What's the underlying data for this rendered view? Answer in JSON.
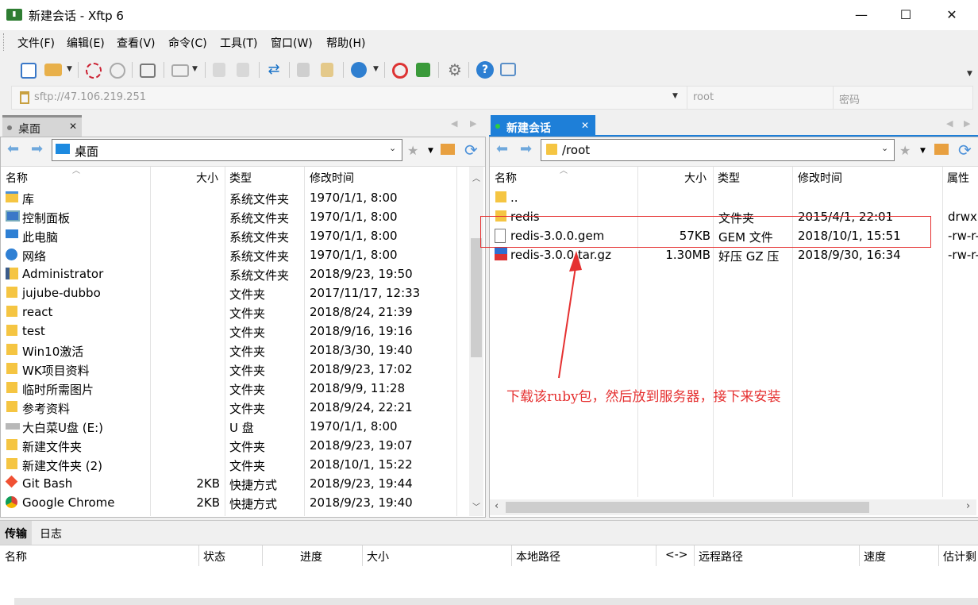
{
  "window": {
    "title": "新建会话  - Xftp 6"
  },
  "menu": [
    "文件(F)",
    "编辑(E)",
    "查看(V)",
    "命令(C)",
    "工具(T)",
    "窗口(W)",
    "帮助(H)"
  ],
  "address": {
    "url": "sftp://47.106.219.251",
    "user": "root",
    "password_placeholder": "密码"
  },
  "left_pane": {
    "tab": "桌面",
    "path": "桌面",
    "columns": [
      "名称",
      "大小",
      "类型",
      "修改时间"
    ],
    "rows": [
      {
        "name": "库",
        "size": "",
        "type": "系统文件夹",
        "date": "1970/1/1, 8:00",
        "icon": "library-icon"
      },
      {
        "name": "控制面板",
        "size": "",
        "type": "系统文件夹",
        "date": "1970/1/1, 8:00",
        "icon": "control-panel-icon"
      },
      {
        "name": "此电脑",
        "size": "",
        "type": "系统文件夹",
        "date": "1970/1/1, 8:00",
        "icon": "computer-icon"
      },
      {
        "name": "网络",
        "size": "",
        "type": "系统文件夹",
        "date": "1970/1/1, 8:00",
        "icon": "network-icon"
      },
      {
        "name": "Administrator",
        "size": "",
        "type": "系统文件夹",
        "date": "2018/9/23, 19:50",
        "icon": "user-folder-icon"
      },
      {
        "name": "jujube-dubbo",
        "size": "",
        "type": "文件夹",
        "date": "2017/11/17, 12:33",
        "icon": "folder-icon"
      },
      {
        "name": "react",
        "size": "",
        "type": "文件夹",
        "date": "2018/8/24, 21:39",
        "icon": "folder-icon"
      },
      {
        "name": "test",
        "size": "",
        "type": "文件夹",
        "date": "2018/9/16, 19:16",
        "icon": "folder-icon"
      },
      {
        "name": "Win10激活",
        "size": "",
        "type": "文件夹",
        "date": "2018/3/30, 19:40",
        "icon": "folder-icon"
      },
      {
        "name": "WK项目资料",
        "size": "",
        "type": "文件夹",
        "date": "2018/9/23, 17:02",
        "icon": "folder-icon"
      },
      {
        "name": "临时所需图片",
        "size": "",
        "type": "文件夹",
        "date": "2018/9/9, 11:28",
        "icon": "folder-icon"
      },
      {
        "name": "参考资料",
        "size": "",
        "type": "文件夹",
        "date": "2018/9/24, 22:21",
        "icon": "folder-icon"
      },
      {
        "name": "大白菜U盘 (E:)",
        "size": "",
        "type": "U 盘",
        "date": "1970/1/1, 8:00",
        "icon": "usb-drive-icon"
      },
      {
        "name": "新建文件夹",
        "size": "",
        "type": "文件夹",
        "date": "2018/9/23, 19:07",
        "icon": "folder-icon"
      },
      {
        "name": "新建文件夹 (2)",
        "size": "",
        "type": "文件夹",
        "date": "2018/10/1, 15:22",
        "icon": "folder-icon"
      },
      {
        "name": "Git Bash",
        "size": "2KB",
        "type": "快捷方式",
        "date": "2018/9/23, 19:44",
        "icon": "git-bash-icon"
      },
      {
        "name": "Google Chrome",
        "size": "2KB",
        "type": "快捷方式",
        "date": "2018/9/23, 19:40",
        "icon": "chrome-icon"
      }
    ]
  },
  "right_pane": {
    "tab": "新建会话",
    "path": "/root",
    "columns": [
      "名称",
      "大小",
      "类型",
      "修改时间",
      "属性"
    ],
    "rows": [
      {
        "name": "..",
        "size": "",
        "type": "",
        "date": "",
        "attr": "",
        "icon": "folder-icon"
      },
      {
        "name": "redis",
        "size": "",
        "type": "文件夹",
        "date": "2015/4/1, 22:01",
        "attr": "drwxr",
        "icon": "folder-icon"
      },
      {
        "name": "redis-3.0.0.gem",
        "size": "57KB",
        "type": "GEM 文件",
        "date": "2018/10/1, 15:51",
        "attr": "-rw-r-",
        "icon": "file-icon"
      },
      {
        "name": "redis-3.0.0.tar.gz",
        "size": "1.30MB",
        "type": "好压 GZ 压",
        "date": "2018/9/30, 16:34",
        "attr": "-rw-r-",
        "icon": "archive-icon"
      }
    ]
  },
  "annotation": {
    "text": "下载该ruby包，然后放到服务器，接下来安装",
    "color": "#e53030"
  },
  "bottom": {
    "tabs": [
      "传输",
      "日志"
    ],
    "columns": [
      "名称",
      "状态",
      "进度",
      "大小",
      "本地路径",
      "<->",
      "远程路径",
      "速度",
      "估计剩"
    ]
  },
  "colors": {
    "accent": "#1e7fd8",
    "folder": "#f5c542"
  }
}
